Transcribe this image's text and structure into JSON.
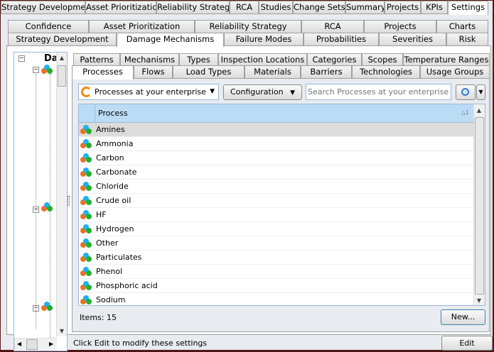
{
  "top_tabs": [
    "Strategy Development",
    "Asset Prioritization",
    "Reliability Strategy",
    "RCA",
    "Studies",
    "Change Sets",
    "Summary",
    "Projects",
    "KPIs",
    "Settings"
  ],
  "settings_tabs_row1": [
    "Confidence",
    "Asset Prioritization",
    "Reliability Strategy",
    "RCA",
    "Projects",
    "Charts"
  ],
  "settings_tabs_row2": [
    "Strategy Development",
    "Damage Mechanisms",
    "Failure Modes",
    "Probabilities",
    "Severities",
    "Risk"
  ],
  "dm_tabs_row1": [
    "Patterns",
    "Mechanisms",
    "Types",
    "Inspection Locations",
    "Categories",
    "Scopes",
    "Temperature Ranges"
  ],
  "dm_tabs_row2": [
    "Processes",
    "Flows",
    "Load Types",
    "Materials",
    "Barriers",
    "Technologies",
    "Usage Groups"
  ],
  "tree": {
    "root_label": "Da"
  },
  "toolbar": {
    "scope": "Processes at your enterprise",
    "configuration": "Configuration",
    "search_placeholder": "Search Processes at your enterprise  (Ctrl"
  },
  "grid": {
    "column": "Process",
    "sort_indicator": "1",
    "rows": [
      "Amines",
      "Ammonia",
      "Carbon",
      "Carbonate",
      "Chloride",
      "Crude oil",
      "HF",
      "Hydrogen",
      "Other",
      "Particulates",
      "Phenol",
      "Phosphoric acid",
      "Sodium"
    ]
  },
  "footer": {
    "items": "Items: 15",
    "new_button": "New...",
    "status": "Click Edit to modify these settings",
    "edit_button": "Edit"
  },
  "colors": {
    "header": "#bcdcf5",
    "frame": "#5a1a1a"
  }
}
